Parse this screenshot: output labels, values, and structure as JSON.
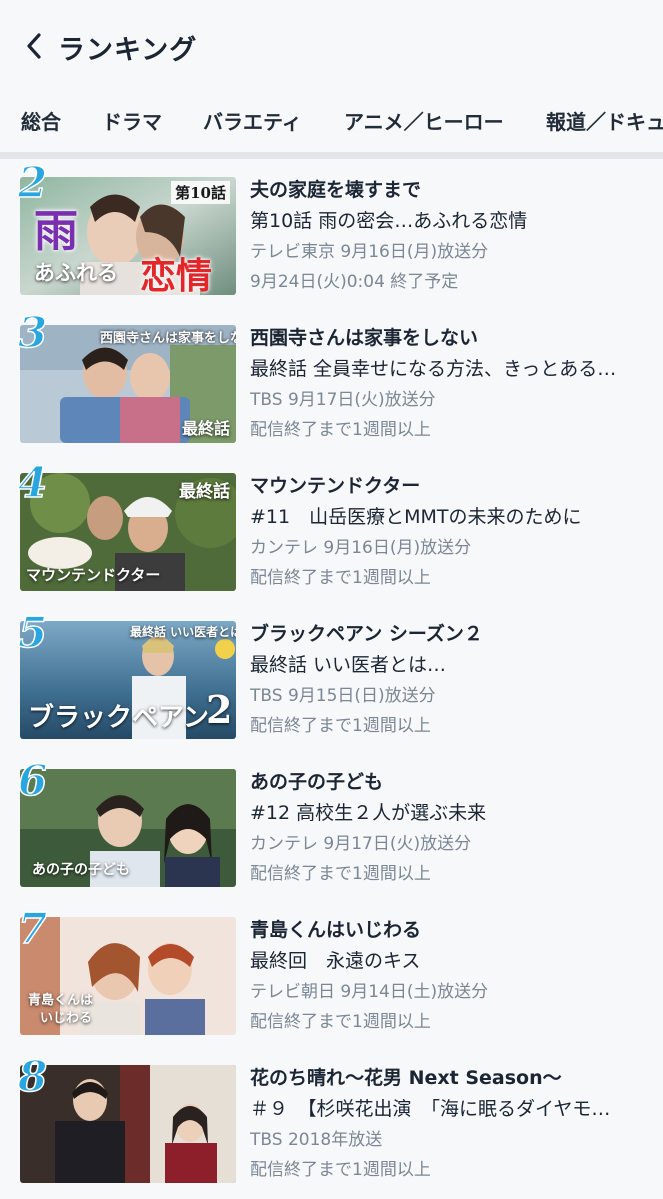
{
  "header": {
    "title": "ランキング",
    "back_icon": "chevron-left-icon"
  },
  "tabs": [
    {
      "label": "総合",
      "active": false
    },
    {
      "label": "ドラマ",
      "active": true
    },
    {
      "label": "バラエティ",
      "active": false
    },
    {
      "label": "アニメ／ヒーロー",
      "active": false
    },
    {
      "label": "報道／ドキュ",
      "active": false
    }
  ],
  "accent_color": "#2aa3dd",
  "items": [
    {
      "rank": "2",
      "show_title": "夫の家庭を壊すまで",
      "episode_title": "第10話 雨の密会…あふれる恋情",
      "broadcast": "テレビ東京 9月16日(月)放送分",
      "status": "9月24日(火)0:04 終了予定",
      "thumb_text": {
        "big1": "雨",
        "small": "あふれる",
        "big2": "恋情",
        "ep": "第10話"
      }
    },
    {
      "rank": "3",
      "show_title": "西園寺さんは家事をしない",
      "episode_title": "最終話 全員幸せになる方法、きっとある…",
      "broadcast": "TBS 9月17日(火)放送分",
      "status": "配信終了まで1週間以上",
      "thumb_text": {
        "logo": "西園寺さんは家事をしない",
        "ep": "最終話"
      }
    },
    {
      "rank": "4",
      "show_title": "マウンテンドクター",
      "episode_title": "#11　山岳医療とMMTの未来のために",
      "broadcast": "カンテレ 9月16日(月)放送分",
      "status": "配信終了まで1週間以上",
      "thumb_text": {
        "ep": "最終話",
        "logo": "マウンテンドクター"
      }
    },
    {
      "rank": "5",
      "show_title": "ブラックペアン シーズン２",
      "episode_title": "最終話 いい医者とは…",
      "broadcast": "TBS 9月15日(日)放送分",
      "status": "配信終了まで1週間以上",
      "thumb_text": {
        "top": "最終話 いい医者とは",
        "logo": "ブラックペアン",
        "num": "2"
      }
    },
    {
      "rank": "6",
      "show_title": "あの子の子ども",
      "episode_title": "#12 高校生２人が選ぶ未来",
      "broadcast": "カンテレ 9月17日(火)放送分",
      "status": "配信終了まで1週間以上",
      "thumb_text": {
        "logo": "あの子の子ども"
      }
    },
    {
      "rank": "7",
      "show_title": "青島くんはいじわる",
      "episode_title": "最終回　永遠のキス",
      "broadcast": "テレビ朝日 9月14日(土)放送分",
      "status": "配信終了まで1週間以上",
      "thumb_text": {
        "logo1": "青島くんは",
        "logo2": "いじわる"
      }
    },
    {
      "rank": "8",
      "show_title": "花のち晴れ〜花男 Next Season〜",
      "episode_title": "＃９　【杉咲花出演　「海に眠るダイヤモ…",
      "broadcast": "TBS 2018年放送",
      "status": "配信終了まで1週間以上",
      "thumb_text": {}
    }
  ]
}
